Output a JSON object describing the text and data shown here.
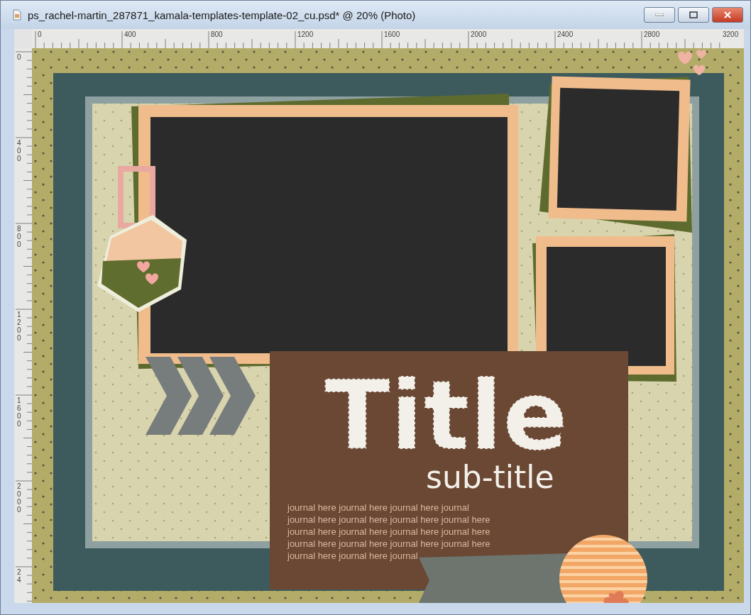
{
  "window": {
    "title": "ps_rachel-martin_287871_kamala-templates-template-02_cu.psd* @ 20% (Photo)"
  },
  "rulers": {
    "horizontal": [
      "0",
      "400",
      "800",
      "1200",
      "1600",
      "2000",
      "2400",
      "2800",
      "3200"
    ],
    "vertical": [
      "0",
      "400",
      "800",
      "1200",
      "1600",
      "2000",
      "24"
    ]
  },
  "canvas": {
    "title": "Title",
    "subtitle": "sub-title",
    "journal": [
      "journal here journal here journal here journal",
      "journal here journal here journal here journal here",
      "journal here journal here journal here journal here",
      "journal here journal here journal here journal here",
      "journal here journal here journal"
    ]
  }
}
